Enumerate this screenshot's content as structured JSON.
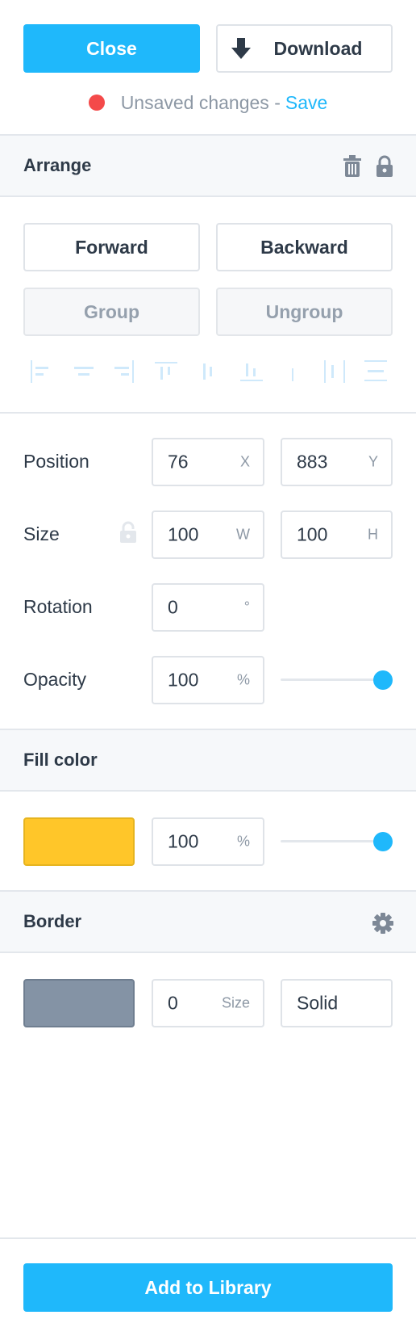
{
  "header": {
    "close_label": "Close",
    "download_label": "Download",
    "status_text": "Unsaved changes -",
    "save_link": "Save"
  },
  "arrange": {
    "title": "Arrange",
    "forward_label": "Forward",
    "backward_label": "Backward",
    "group_label": "Group",
    "ungroup_label": "Ungroup",
    "align_icons": [
      "align-left-icon",
      "align-center-horizontal-icon",
      "align-right-icon",
      "align-top-icon",
      "align-middle-vertical-icon",
      "align-bottom-icon",
      "align-center-line-icon",
      "distribute-horizontal-icon",
      "distribute-vertical-icon"
    ]
  },
  "transform": {
    "position_label": "Position",
    "position_x": "76",
    "position_x_unit": "X",
    "position_y": "883",
    "position_y_unit": "Y",
    "size_label": "Size",
    "size_w": "100",
    "size_w_unit": "W",
    "size_h": "100",
    "size_h_unit": "H",
    "rotation_label": "Rotation",
    "rotation_value": "0",
    "rotation_unit": "°",
    "opacity_label": "Opacity",
    "opacity_value": "100",
    "opacity_unit": "%",
    "opacity_slider_level": 1.0
  },
  "fill": {
    "title": "Fill color",
    "color": "#ffc629",
    "opacity_value": "100",
    "opacity_unit": "%",
    "opacity_slider_level": 1.0
  },
  "border": {
    "title": "Border",
    "color": "#8493a5",
    "size_value": "0",
    "size_unit": "Size",
    "style_value": "Solid"
  },
  "footer": {
    "add_library_label": "Add to Library"
  },
  "colors": {
    "accent": "#1fb8fb",
    "unsaved_dot": "#f44a4a",
    "text_dark": "#2e3a48",
    "text_muted": "#8d98a5"
  }
}
